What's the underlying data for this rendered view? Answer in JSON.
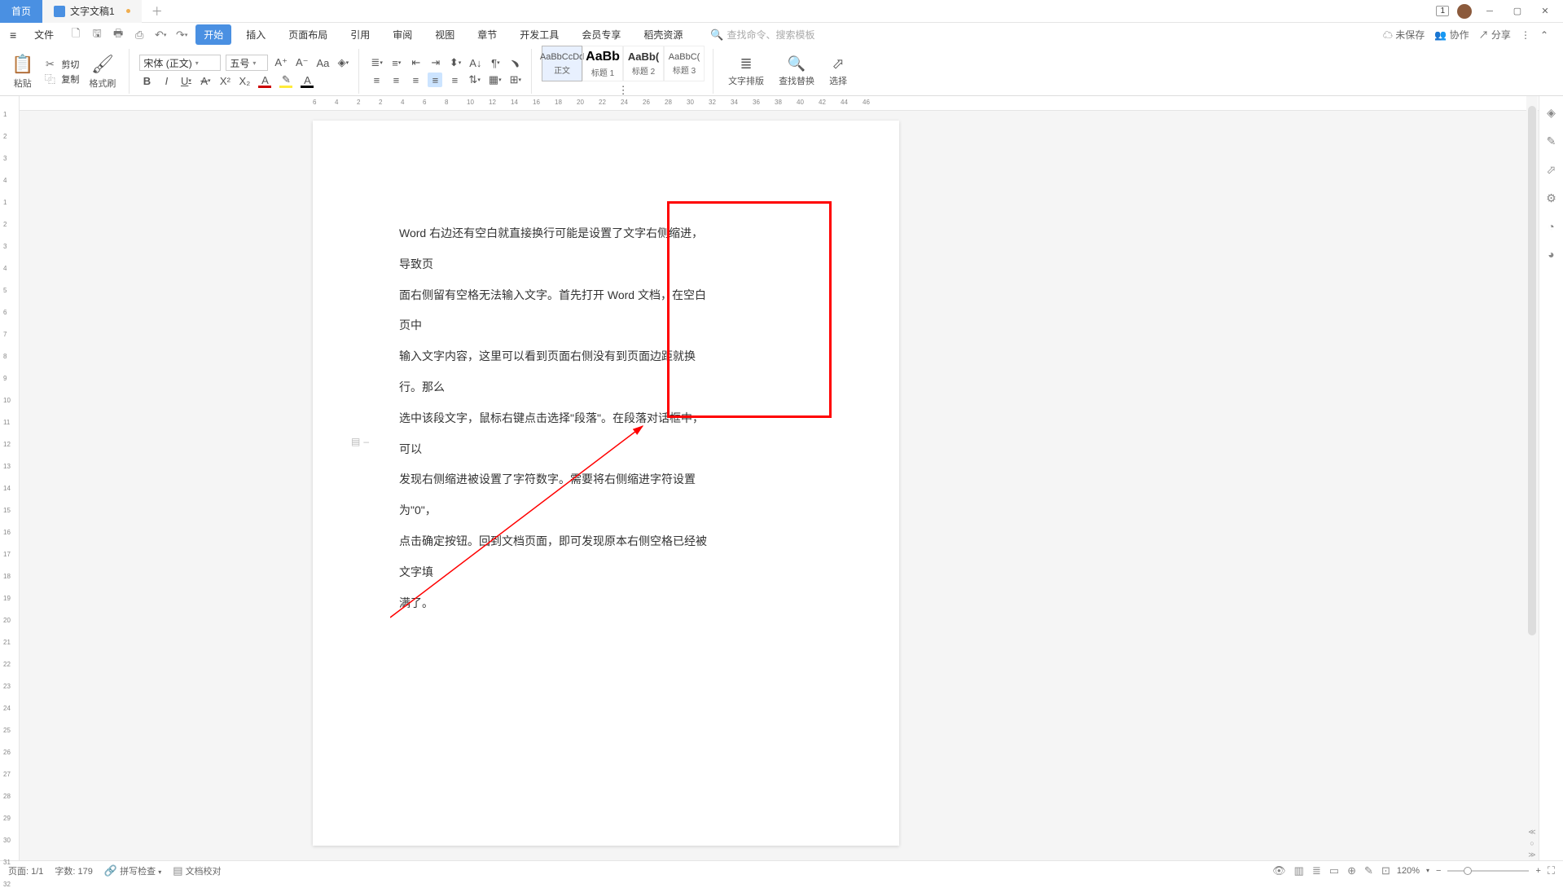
{
  "tabs": {
    "home": "首页",
    "doc": "文字文稿1"
  },
  "titleright": {
    "badge": "1"
  },
  "menubar": {
    "file": "文件",
    "items": [
      "开始",
      "插入",
      "页面布局",
      "引用",
      "审阅",
      "视图",
      "章节",
      "开发工具",
      "会员专享",
      "稻壳资源"
    ],
    "search_cmd": "查找命令、搜索模板",
    "unsaved": "未保存",
    "collab": "协作",
    "share": "分享"
  },
  "ribbon": {
    "paste": "粘贴",
    "cut": "剪切",
    "copy": "复制",
    "formatpainter": "格式刷",
    "font": "宋体 (正文)",
    "fontsize": "五号",
    "styles": [
      {
        "preview": "AaBbCcDd",
        "label": "正文"
      },
      {
        "preview": "AaBb",
        "label": "标题 1"
      },
      {
        "preview": "AaBb(",
        "label": "标题 2"
      },
      {
        "preview": "AaBbC(",
        "label": "标题 3"
      }
    ],
    "textlayout": "文字排版",
    "findreplace": "查找替换",
    "select": "选择"
  },
  "ruler_h": [
    6,
    4,
    2,
    2,
    4,
    6,
    8,
    10,
    12,
    14,
    16,
    18,
    20,
    22,
    24,
    26,
    28,
    30,
    32,
    34,
    36,
    38,
    40,
    42,
    44,
    46
  ],
  "ruler_v": [
    1,
    2,
    3,
    4,
    1,
    2,
    3,
    4,
    5,
    6,
    7,
    8,
    9,
    10,
    11,
    12,
    13,
    14,
    15,
    16,
    17,
    18,
    19,
    20,
    21,
    22,
    23,
    24,
    25,
    26,
    27,
    28,
    29,
    30,
    31,
    32
  ],
  "document": {
    "para1": "Word 右边还有空白就直接换行可能是设置了文字右侧缩进，导致页",
    "para2": "面右侧留有空格无法输入文字。首先打开 Word 文档，在空白页中",
    "para3": "输入文字内容，这里可以看到页面右侧没有到页面边距就换行。那么",
    "para4": "选中该段文字，鼠标右键点击选择\"段落\"。在段落对话框中，可以",
    "para5": "发现右侧缩进被设置了字符数字。需要将右侧缩进字符设置为\"0\"，",
    "para6": "点击确定按钮。回到文档页面，即可发现原本右侧空格已经被文字填",
    "para7": "满了。"
  },
  "status": {
    "page": "页面: 1/1",
    "words": "字数: 179",
    "spell": "拼写检查",
    "proof": "文档校对",
    "zoom": "120%"
  }
}
